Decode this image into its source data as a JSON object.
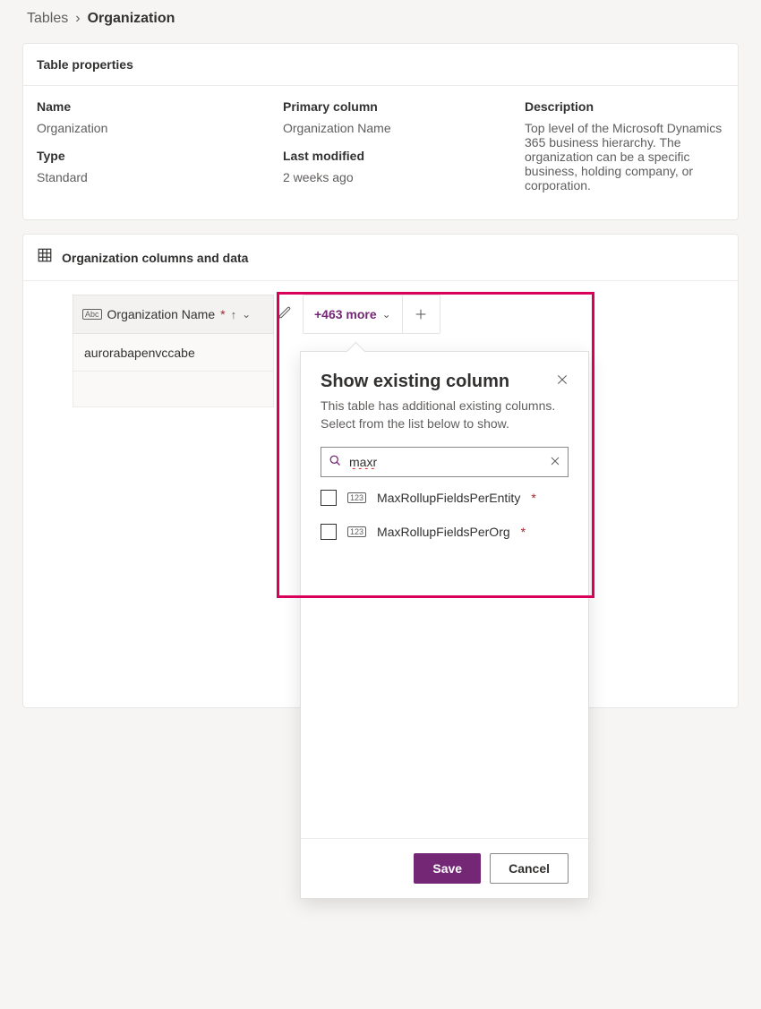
{
  "breadcrumb": {
    "parent": "Tables",
    "current": "Organization"
  },
  "properties_panel": {
    "title": "Table properties",
    "name_label": "Name",
    "name_value": "Organization",
    "type_label": "Type",
    "type_value": "Standard",
    "primary_label": "Primary column",
    "primary_value": "Organization Name",
    "modified_label": "Last modified",
    "modified_value": "2 weeks ago",
    "description_label": "Description",
    "description_value": "Top level of the Microsoft Dynamics 365 business hierarchy. The organization can be a specific business, holding company, or corporation."
  },
  "data_panel": {
    "title": "Organization columns and data",
    "column_header": "Organization Name",
    "more_label": "+463 more",
    "row_value": "aurorabapenvccabe"
  },
  "popover": {
    "title": "Show existing column",
    "description": "This table has additional existing columns. Select from the list below to show.",
    "search_value": "maxr",
    "options": [
      {
        "label": "MaxRollupFieldsPerEntity"
      },
      {
        "label": "MaxRollupFieldsPerOrg"
      }
    ],
    "save_label": "Save",
    "cancel_label": "Cancel"
  }
}
